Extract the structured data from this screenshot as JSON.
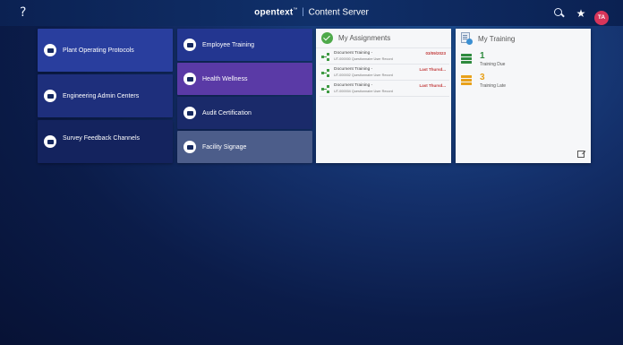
{
  "header": {
    "help_label": "?",
    "brand_logo": "opentext",
    "brand_tm": "™",
    "brand_separator": "|",
    "brand_product": "Content Server",
    "favorites_icon": "★",
    "user_initials": "TA",
    "avatar_color": "#d7355a"
  },
  "tiles": [
    {
      "label": "Plant Operating Protocols",
      "icon": "folder-icon"
    },
    {
      "label": "Engineering Admin Centers",
      "icon": "folder-icon"
    },
    {
      "label": "Survey Feedback Channels",
      "icon": "folder-icon"
    },
    {
      "label": "Employee Training",
      "icon": "folder-icon"
    },
    {
      "label": "Health Wellness",
      "icon": "folder-icon"
    },
    {
      "label": "Audit Certification",
      "icon": "folder-icon"
    },
    {
      "label": "Facility Signage",
      "icon": "folder-icon"
    }
  ],
  "assignments": {
    "title": "My Assignments",
    "items": [
      {
        "title": "Document Training -",
        "subtitle": "UT-000000 Questionnaire User Record",
        "due": "03/09/2023"
      },
      {
        "title": "Document Training -",
        "subtitle": "UT-000002 Questionnaire User Record",
        "due": "Last Thursd..."
      },
      {
        "title": "Document Training -",
        "subtitle": "UT-000004 Questionnaire User Record",
        "due": "Last Thursd..."
      }
    ]
  },
  "training": {
    "title": "My Training",
    "due_count": "1",
    "due_label": "Training Due",
    "due_color": "#2e8a3e",
    "late_count": "3",
    "late_label": "Training Late",
    "late_color": "#e8a11b"
  }
}
